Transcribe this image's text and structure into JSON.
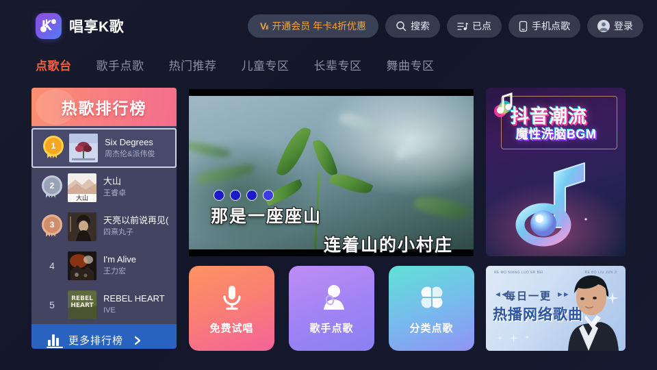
{
  "app": {
    "brand_name": "唱享K歌",
    "logo_icon": "karaoke-k-logo"
  },
  "header": {
    "vip_banner": {
      "badge": "V",
      "label": "开通会员 年卡4折优惠",
      "color": "#f5a33c"
    },
    "buttons": [
      {
        "label": "搜索",
        "icon": "search-icon"
      },
      {
        "label": "已点",
        "icon": "playlist-icon"
      },
      {
        "label": "手机点歌",
        "icon": "phone-icon"
      },
      {
        "label": "登录",
        "icon": "user-avatar-icon"
      }
    ]
  },
  "nav": {
    "tabs": [
      {
        "label": "点歌台",
        "active": true
      },
      {
        "label": "歌手点歌",
        "active": false
      },
      {
        "label": "热门推荐",
        "active": false
      },
      {
        "label": "儿童专区",
        "active": false
      },
      {
        "label": "长辈专区",
        "active": false
      },
      {
        "label": "舞曲专区",
        "active": false
      }
    ],
    "active_color": "#f4603f",
    "inactive_color": "#8a90a8"
  },
  "rank_panel": {
    "title": "热歌排行榜",
    "items": [
      {
        "rank": "1",
        "title": "Six Degrees",
        "artist": "周杰伦&派伟俊",
        "medal": "gold",
        "selected": true
      },
      {
        "rank": "2",
        "title": "大山",
        "artist": "王睿卓",
        "medal": "silver",
        "selected": false
      },
      {
        "rank": "3",
        "title": "天亮以前说再见(",
        "artist": "四熹丸子",
        "medal": "bronze",
        "selected": false
      },
      {
        "rank": "4",
        "title": "I'm Alive",
        "artist": "王力宏",
        "medal": "none",
        "selected": false
      },
      {
        "rank": "5",
        "title": "REBEL HEART",
        "artist": "IVE",
        "medal": "none",
        "selected": false
      }
    ],
    "more_button": {
      "label": "更多排行榜",
      "icon": "bar-chart-icon",
      "chevron": "chevron-right-icon",
      "color": "#2a62bf"
    }
  },
  "video": {
    "lyric_line_1": "那是一座座山",
    "lyric_line_2": "连着山的小村庄",
    "countdown_dots": 4
  },
  "promo_douyin": {
    "title": "抖音潮流",
    "subtitle": "魔性洗脑BGM",
    "icon": "music-note-icon"
  },
  "action_cards": [
    {
      "label": "免费试唱",
      "icon": "microphone-icon"
    },
    {
      "label": "歌手点歌",
      "icon": "singer-icon"
    },
    {
      "label": "分类点歌",
      "icon": "category-flower-icon"
    }
  ],
  "promo_daily": {
    "top_left": "RE MO NIANG LUO ER BEI",
    "top_right": "RE BO LIU JUN JI",
    "arrows_left": "◄◄",
    "arrows_right": "►►",
    "title": "每日一更",
    "subtitle": "热播网络歌曲"
  }
}
